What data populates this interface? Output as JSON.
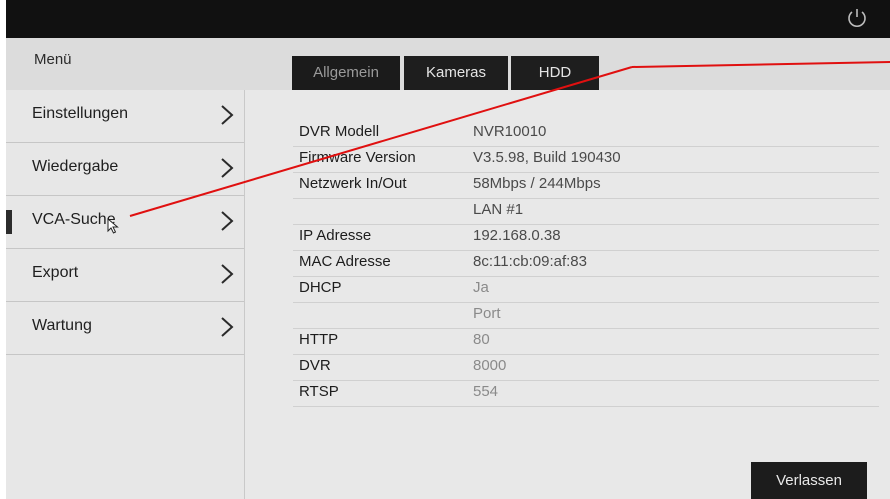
{
  "header": {
    "menu_title": "Menü"
  },
  "tabs": [
    {
      "label": "Allgemein",
      "active": true
    },
    {
      "label": "Kameras",
      "active": false
    },
    {
      "label": "HDD",
      "active": false
    }
  ],
  "sidebar": {
    "items": [
      {
        "label": "Einstellungen",
        "selected": false
      },
      {
        "label": "Wiedergabe",
        "selected": false
      },
      {
        "label": "VCA-Suche",
        "selected": true
      },
      {
        "label": "Export",
        "selected": false
      },
      {
        "label": "Wartung",
        "selected": false
      }
    ]
  },
  "info": {
    "rows": [
      {
        "key": "DVR Modell",
        "value": "NVR10010"
      },
      {
        "key": "Firmware Version",
        "value": "V3.5.98, Build 190430"
      },
      {
        "key": "Netzwerk In/Out",
        "value": "58Mbps / 244Mbps"
      },
      {
        "key": "",
        "value": "LAN #1"
      },
      {
        "key": "IP Adresse",
        "value": "192.168.0.38"
      },
      {
        "key": "MAC Adresse",
        "value": "8c:11:cb:09:af:83"
      },
      {
        "key": "DHCP",
        "value": "Ja"
      },
      {
        "key": "",
        "value": "Port"
      },
      {
        "key": "HTTP",
        "value": "80"
      },
      {
        "key": "DVR",
        "value": "8000"
      },
      {
        "key": "RTSP",
        "value": "554"
      }
    ]
  },
  "footer": {
    "exit_label": "Verlassen"
  },
  "icons": {
    "power": "power-icon",
    "chevron": "chevron-right-icon",
    "cursor": "mouse-cursor-icon"
  },
  "colors": {
    "topbar": "#111111",
    "tab_bg": "#1e1e1e",
    "annotation_line": "#e01010"
  }
}
